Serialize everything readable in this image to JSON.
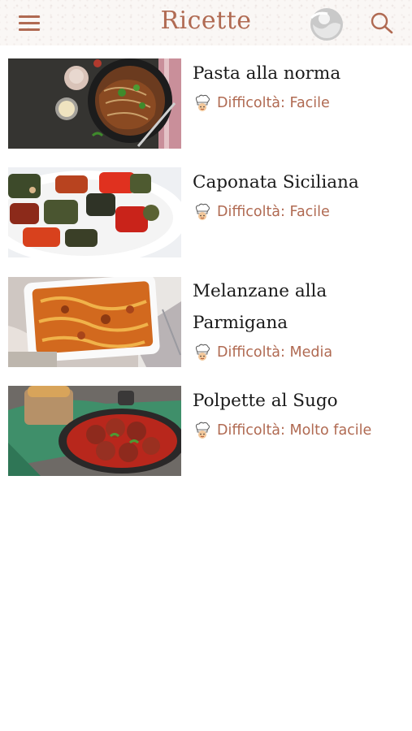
{
  "header": {
    "title": "Ricette",
    "menu_icon": "hamburger-menu-icon",
    "logo_icon": "logo-icon",
    "search_icon": "search-icon",
    "accent_color": "#b06a52"
  },
  "recipes": [
    {
      "title": "Pasta alla norma",
      "difficulty": "Difficoltà: Facile",
      "image": "spaghetti-bowl-image",
      "icon": "chef-hat-icon"
    },
    {
      "title": "Caponata Siciliana",
      "difficulty": "Difficoltà: Facile",
      "image": "caponata-vegetables-image",
      "icon": "chef-hat-icon"
    },
    {
      "title": "Melanzane alla Parmigana",
      "difficulty": "Difficoltà: Media",
      "image": "eggplant-parmigiana-dish-image",
      "icon": "chef-hat-icon"
    },
    {
      "title": "Polpette al Sugo",
      "difficulty": "Difficoltà: Molto facile",
      "image": "meatballs-in-sauce-image",
      "icon": "chef-hat-icon"
    }
  ]
}
